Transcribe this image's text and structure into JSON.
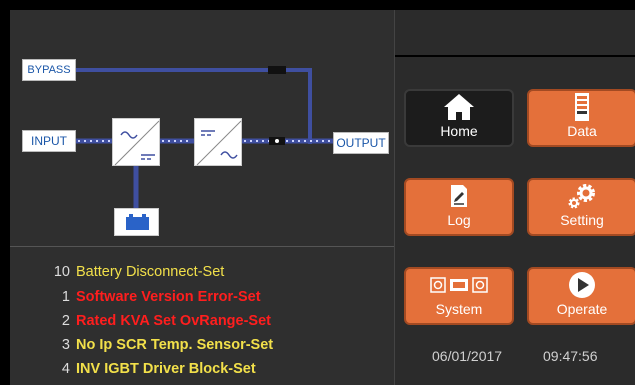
{
  "diagram": {
    "bypass_label": "BYPASS",
    "input_label": "INPUT",
    "output_label": "OUTPUT"
  },
  "alarms": [
    {
      "num": "10",
      "text": "Battery Disconnect-Set",
      "color": "#f2e04a"
    },
    {
      "num": "1",
      "text": "Software Version Error-Set",
      "color": "#ff1e1e"
    },
    {
      "num": "2",
      "text": "Rated KVA Set OvRange-Set",
      "color": "#ff1e1e"
    },
    {
      "num": "3",
      "text": "No Ip SCR Temp. Sensor-Set",
      "color": "#f2e04a"
    },
    {
      "num": "4",
      "text": "INV IGBT Driver Block-Set",
      "color": "#f2e04a"
    }
  ],
  "menu": {
    "home": {
      "label": "Home",
      "icon": "home-icon"
    },
    "data": {
      "label": "Data",
      "icon": "battery-data-icon"
    },
    "log": {
      "label": "Log",
      "icon": "log-icon"
    },
    "setting": {
      "label": "Setting",
      "icon": "gears-icon"
    },
    "system": {
      "label": "System",
      "icon": "system-icon"
    },
    "operate": {
      "label": "Operate",
      "icon": "play-icon"
    }
  },
  "status": {
    "date": "06/01/2017",
    "time": "09:47:56"
  },
  "colors": {
    "accent_orange": "#e4703a",
    "line_blue": "#3f4fa0",
    "label_blue": "#1a56a8"
  }
}
